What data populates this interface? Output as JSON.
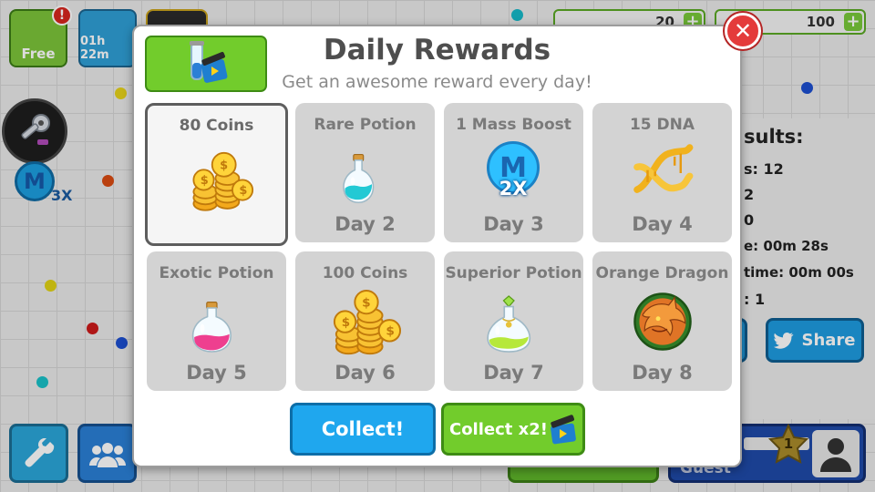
{
  "hud": {
    "free_label": "Free",
    "timer_label": "01h 22m",
    "coins_value": "20",
    "dna_value": "100",
    "plus_symbol": "+"
  },
  "results_panel": {
    "title": "sults:",
    "rows": [
      "s: 12",
      "2",
      "0",
      "e: 00m 28s",
      "time: 00m 00s",
      ": 1"
    ]
  },
  "share_label": "Share",
  "guest_label": "Guest",
  "level_badge": "1",
  "mass_boost_badge": "3X",
  "dialog": {
    "title": "Daily Rewards",
    "subtitle": "Get an awesome reward every day!",
    "close_symbol": "✕",
    "collect_label": "Collect!",
    "collect_x2_label": "Collect x2!"
  },
  "rewards": [
    {
      "name": "80 Coins",
      "day": "",
      "icon": "coins-icon",
      "selected": true
    },
    {
      "name": "Rare Potion",
      "day": "Day 2",
      "icon": "cyan-potion-icon"
    },
    {
      "name": "1 Mass Boost",
      "day": "Day 3",
      "icon": "mass-boost-2x-icon",
      "badge": "2X",
      "letter": "M"
    },
    {
      "name": "15 DNA",
      "day": "Day 4",
      "icon": "dna-icon"
    },
    {
      "name": "Exotic Potion",
      "day": "Day 5",
      "icon": "pink-potion-icon"
    },
    {
      "name": "100 Coins",
      "day": "Day 6",
      "icon": "coins-icon"
    },
    {
      "name": "Superior Potion",
      "day": "Day 7",
      "icon": "green-potion-icon"
    },
    {
      "name": "Orange Dragon",
      "day": "Day 8",
      "icon": "dragon-skin-icon"
    }
  ],
  "colors": {
    "accent_green": "#72cc2c",
    "accent_blue": "#1fa7ee",
    "close_red": "#e43b3b"
  }
}
